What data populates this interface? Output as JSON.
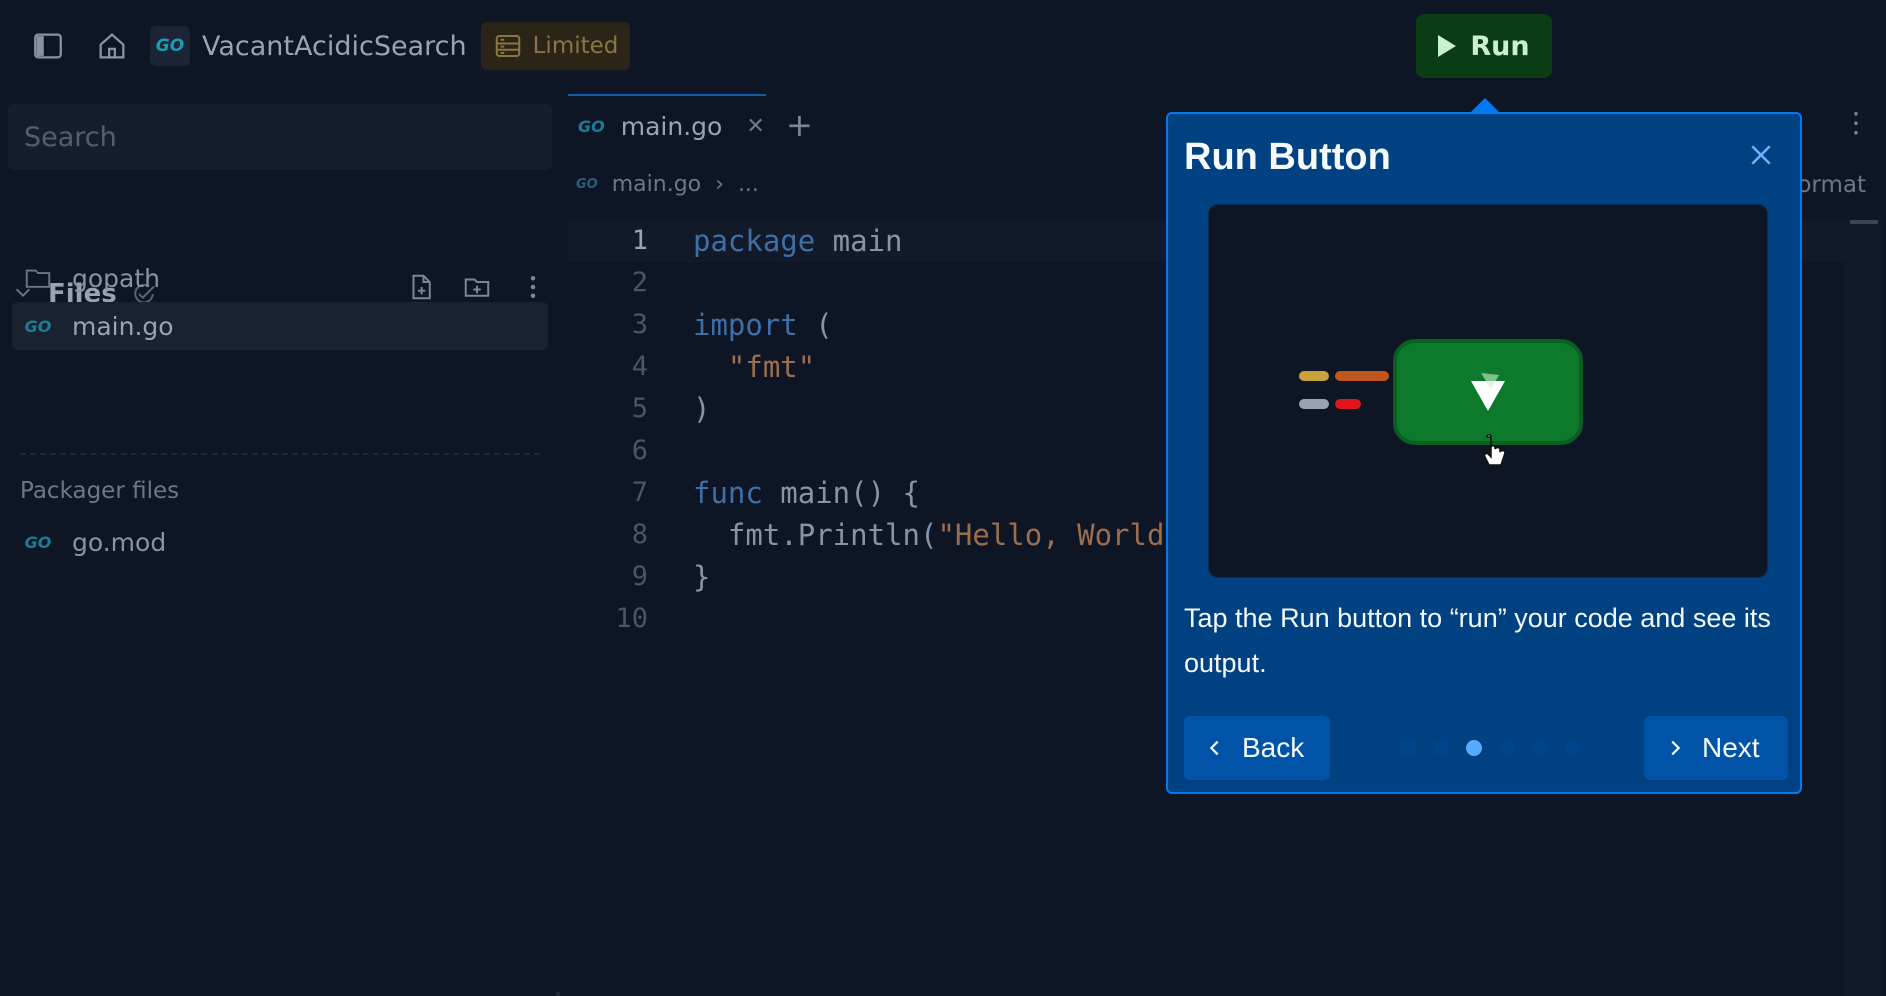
{
  "topbar": {
    "repl_name": "VacantAcidicSearch",
    "limited_label": "Limited",
    "run_label": "Run"
  },
  "sidebar": {
    "search_placeholder": "Search",
    "files_title": "Files",
    "items": [
      {
        "label": "gopath",
        "icon": "folder-icon"
      },
      {
        "label": "main.go",
        "icon": "go-file-icon"
      }
    ],
    "packager_label": "Packager files",
    "packager_items": [
      {
        "label": "go.mod",
        "icon": "go-file-icon"
      }
    ]
  },
  "editor": {
    "tab_label": "main.go",
    "breadcrumb_file": "main.go",
    "breadcrumb_more": "...",
    "format_label": "ormat",
    "line_numbers": [
      "1",
      "2",
      "3",
      "4",
      "5",
      "6",
      "7",
      "8",
      "9",
      "10"
    ]
  },
  "tour": {
    "title": "Run Button",
    "description": "Tap the Run button to “run” your code and see its output.",
    "back_label": "Back",
    "next_label": "Next",
    "step_count": 6,
    "current_step": 3
  },
  "colors": {
    "background": "#0e1525",
    "popover_bg": "#004182",
    "popover_border": "#0079f2",
    "run_green": "#0a3d14"
  }
}
